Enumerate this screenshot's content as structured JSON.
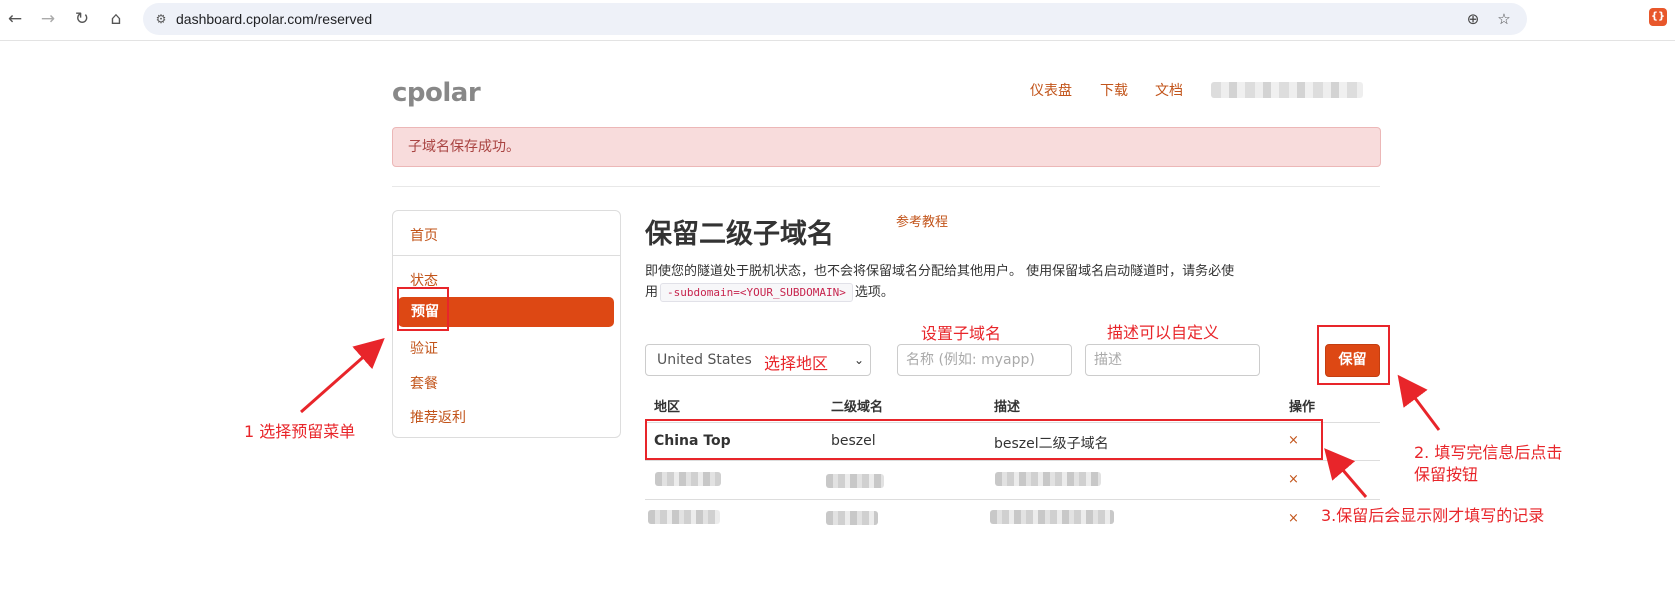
{
  "browser": {
    "url": "dashboard.cpolar.com/reserved"
  },
  "header": {
    "logo": "cpolar",
    "links": [
      "仪表盘",
      "下载",
      "文档"
    ]
  },
  "alert": {
    "message": "子域名保存成功。"
  },
  "sidebar": {
    "items": [
      {
        "label": "首页"
      },
      {
        "label": "状态"
      },
      {
        "label": "预留",
        "active": true
      },
      {
        "label": "验证"
      },
      {
        "label": "套餐"
      },
      {
        "label": "推荐返利"
      }
    ]
  },
  "main": {
    "title": "保留二级子域名",
    "tutorial_link": "参考教程",
    "description_before": "即使您的隧道处于脱机状态，也不会将保留域名分配给其他用户。 使用保留域名启动隧道时，请务必使用",
    "description_code": "-subdomain=<YOUR_SUBDOMAIN>",
    "description_after": "选项。",
    "form": {
      "region_value": "United States",
      "subdomain_placeholder": "名称 (例如: myapp)",
      "desc_placeholder": "描述",
      "reserve_button": "保留"
    },
    "table": {
      "headers": [
        "地区",
        "二级域名",
        "描述",
        "操作"
      ],
      "rows": [
        {
          "region": "China Top",
          "subdomain": "beszel",
          "description": "beszel二级子域名",
          "action": "×"
        },
        {
          "region": "",
          "subdomain": "",
          "description": "",
          "action": "×"
        },
        {
          "region": "",
          "subdomain": "",
          "description": "",
          "action": "×"
        }
      ]
    }
  },
  "annotations": {
    "select_region": "选择地区",
    "set_subdomain": "设置子域名",
    "custom_desc": "描述可以自定义",
    "step1": "1 选择预留菜单",
    "step2_line1": "2. 填写完信息后点击",
    "step2_line2": "保留按钮",
    "step3": "3.保留后会显示刚才填写的记录"
  },
  "colors": {
    "accent": "#dd4814",
    "link": "#c2541a",
    "annotation": "#e8252a",
    "alert_bg": "#f8dcdc"
  }
}
